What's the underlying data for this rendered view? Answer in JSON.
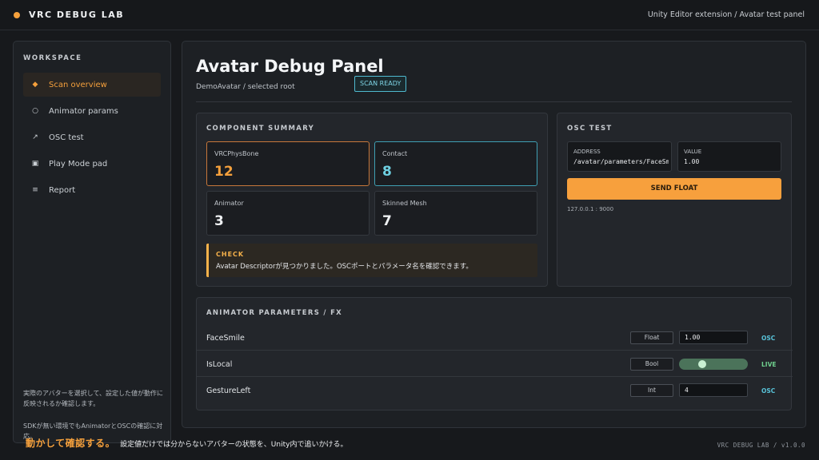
{
  "app": {
    "brand": "VRC DEBUG LAB",
    "subtitle": "Unity Editor extension / Avatar test panel",
    "accent_color": "#f5a03c"
  },
  "sidebar": {
    "heading": "WORKSPACE",
    "items": [
      {
        "icon": "diamond-icon",
        "label": "Scan overview",
        "active": true
      },
      {
        "icon": "circle-icon",
        "label": "Animator params",
        "active": false
      },
      {
        "icon": "arrow-up-right-icon",
        "label": "OSC test",
        "active": false
      },
      {
        "icon": "square-dot-icon",
        "label": "Play Mode pad",
        "active": false
      },
      {
        "icon": "menu-lines-icon",
        "label": "Report",
        "active": false
      }
    ],
    "note_1": "実際のアバターを選択して、設定した値が動作に反映されるか確認します。",
    "note_2": "SDKが無い環境でもAnimatorとOSCの確認に対応。"
  },
  "main": {
    "title": "Avatar Debug Panel",
    "subtitle": "DemoAvatar / selected root",
    "status_badge": "SCAN READY"
  },
  "component_summary": {
    "heading": "COMPONENT SUMMARY",
    "cards": [
      {
        "label": "VRCPhysBone",
        "value": "12",
        "accent": "#f5a03c"
      },
      {
        "label": "Contact",
        "value": "8",
        "accent": "#6fd0e2"
      },
      {
        "label": "Animator",
        "value": "3"
      },
      {
        "label": "Skinned Mesh",
        "value": "7"
      }
    ],
    "check": {
      "title": "CHECK",
      "text": "Avatar Descriptorが見つかりました。OSCポートとパラメータ名を確認できます。"
    }
  },
  "osc_test": {
    "heading": "OSC TEST",
    "address_label": "ADDRESS",
    "address_value": "/avatar/parameters/FaceSmile",
    "value_label": "VALUE",
    "value_value": "1.00",
    "send_label": "SEND FLOAT",
    "endpoint": "127.0.0.1 : 9000"
  },
  "animator_parameters": {
    "heading": "ANIMATOR PARAMETERS / FX",
    "rows": [
      {
        "name": "FaceSmile",
        "type": "Float",
        "value": "1.00",
        "route": "OSC"
      },
      {
        "name": "IsLocal",
        "type": "Bool",
        "value": true,
        "route": "LIVE"
      },
      {
        "name": "GestureLeft",
        "type": "Int",
        "value": "4",
        "route": "OSC"
      }
    ]
  },
  "footer": {
    "tagline_strong": "動かして確認する。",
    "tagline_rest": "設定値だけでは分からないアバターの状態を、Unity内で追いかける。",
    "version": "VRC DEBUG LAB / v1.0.0"
  }
}
